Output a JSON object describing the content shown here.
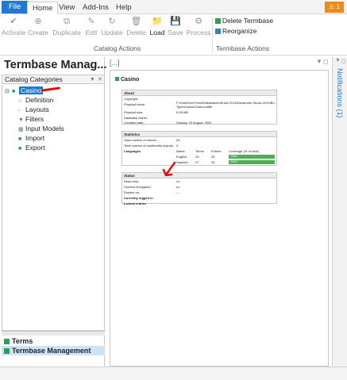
{
  "menu": {
    "tabs": [
      "File",
      "Home",
      "View",
      "Add-Ins",
      "Help"
    ],
    "notification_count": "1"
  },
  "ribbon": {
    "buttons": [
      {
        "label": "Activate",
        "icon": "checkmark-icon"
      },
      {
        "label": "Create",
        "icon": "plus-circle-icon"
      },
      {
        "label": "Duplicate",
        "icon": "duplicate-icon"
      },
      {
        "label": "Edit",
        "icon": "edit-icon"
      },
      {
        "label": "Update",
        "icon": "refresh-icon"
      },
      {
        "label": "Delete",
        "icon": "trash-icon"
      },
      {
        "label": "Load",
        "icon": "folder-icon"
      },
      {
        "label": "Save",
        "icon": "save-icon"
      },
      {
        "label": "Process",
        "icon": "gears-icon"
      }
    ],
    "catalog_group_label": "Catalog Actions",
    "termbase_group_label": "Termbase Actions",
    "delete_termbase_label": "Delete Termbase",
    "reorganize_label": "Reorganize"
  },
  "left_panel": {
    "title": "Termbase Manag...",
    "catalog_header": "Catalog Categories",
    "tree": [
      {
        "label": "Casino",
        "icon": "database-icon"
      },
      {
        "label": "Definition",
        "icon": "definition-icon"
      },
      {
        "label": "Layouts",
        "icon": "layout-icon"
      },
      {
        "label": "Filters",
        "icon": "filter-icon"
      },
      {
        "label": "Input Models",
        "icon": "input-model-icon"
      },
      {
        "label": "Import",
        "icon": "import-icon"
      },
      {
        "label": "Export",
        "icon": "export-icon"
      }
    ],
    "nav": [
      {
        "label": "Terms"
      },
      {
        "label": "Termbase Management"
      }
    ]
  },
  "main": {
    "breadcrumb": "[...]",
    "db_name": "Casino",
    "about": {
      "heading": "About",
      "rows": [
        {
          "k": "Copyright:",
          "v": ""
        },
        {
          "k": "Physical name:",
          "v": "F:\\OneDrive\\Trivini\\Databases\\Studio 2019\\Desarrollo Studio 2019\\Bu Type\\Casino\\Casino.sdltb"
        },
        {
          "k": "Physical size:",
          "v": "5.28 MB"
        },
        {
          "k": "Database owner:",
          "v": ""
        },
        {
          "k": "Creation date:",
          "v": "Sunday, 23 August, 2020"
        }
      ]
    },
    "statistics": {
      "heading": "Statistics",
      "rows": [
        {
          "k": "Total number of entries:",
          "v": "26"
        },
        {
          "k": "Total number of multimedia objects:",
          "v": "0"
        }
      ],
      "lang_heading": "Languages",
      "lang_cols": [
        "Name",
        "Terms",
        "Entries",
        "Coverage (% of total)"
      ],
      "langs": [
        {
          "name": "English:",
          "terms": "28",
          "entries": "26",
          "coverage": "100%",
          "fill": 1.0
        },
        {
          "name": "Spanish:",
          "terms": "27",
          "entries": "26",
          "coverage": "100%",
          "fill": 1.0
        }
      ]
    },
    "status": {
      "heading": "Status",
      "rows": [
        {
          "k": "Read only:",
          "v": "no"
        },
        {
          "k": "Content encryption:",
          "v": "no"
        },
        {
          "k": "Expires on:",
          "v": "---"
        }
      ],
      "logged_in": "Currently logged in",
      "locked": "Locked entries"
    }
  },
  "right_sidebar": {
    "notifications_label": "Notifications (1)"
  },
  "colors": {
    "accent": "#1f7ad6",
    "green": "#2e9d5a",
    "annotation_red": "#e01010"
  }
}
